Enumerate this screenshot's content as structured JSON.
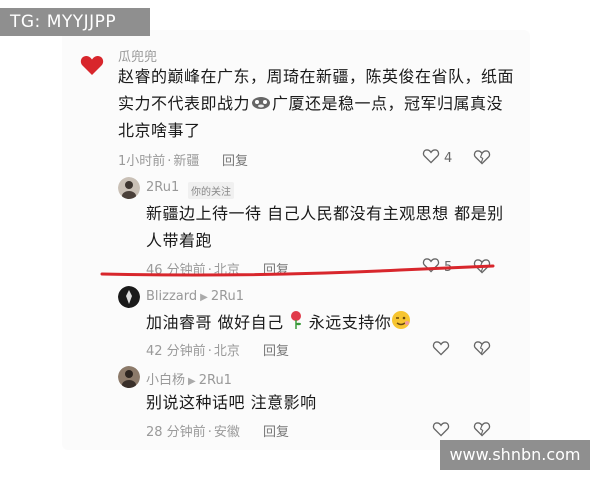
{
  "watermark_top": "TG: MYYJJPP",
  "watermark_bottom": "www.shnbn.com",
  "colors": {
    "accent_red": "#d8262c",
    "meta_gray": "#9a9a9a"
  },
  "comments": [
    {
      "username": "瓜兜兜",
      "avatar_icon": "heart-icon",
      "text_lines": [
        "赵睿的巅峰在广东，周琦在新疆，陈英俊在省队，纸面",
        "实力不代表即战力",
        "广厦还是稳一点，冠军归属真没",
        "北京啥事了"
      ],
      "time": "1小时前",
      "location": "新疆",
      "reply_label": "回复",
      "likes": "4"
    },
    {
      "username": "2Ru1",
      "follow_tag": "你的关注",
      "text_lines": [
        "新疆边上待一待 自己人民都没有主观思想 都是别",
        "人带着跑"
      ],
      "time": "46 分钟前",
      "location": "北京",
      "reply_label": "回复",
      "likes": "5"
    },
    {
      "username": "Blizzard",
      "reply_to": "2Ru1",
      "text_parts": [
        "加油睿哥 做好自己",
        "永远支持你"
      ],
      "time": "42 分钟前",
      "location": "北京",
      "reply_label": "回复"
    },
    {
      "username": "小白杨",
      "reply_to": "2Ru1",
      "text_lines": [
        "别说这种话吧 注意影响"
      ],
      "time": "28 分钟前",
      "location": "安徽",
      "reply_label": "回复"
    }
  ]
}
